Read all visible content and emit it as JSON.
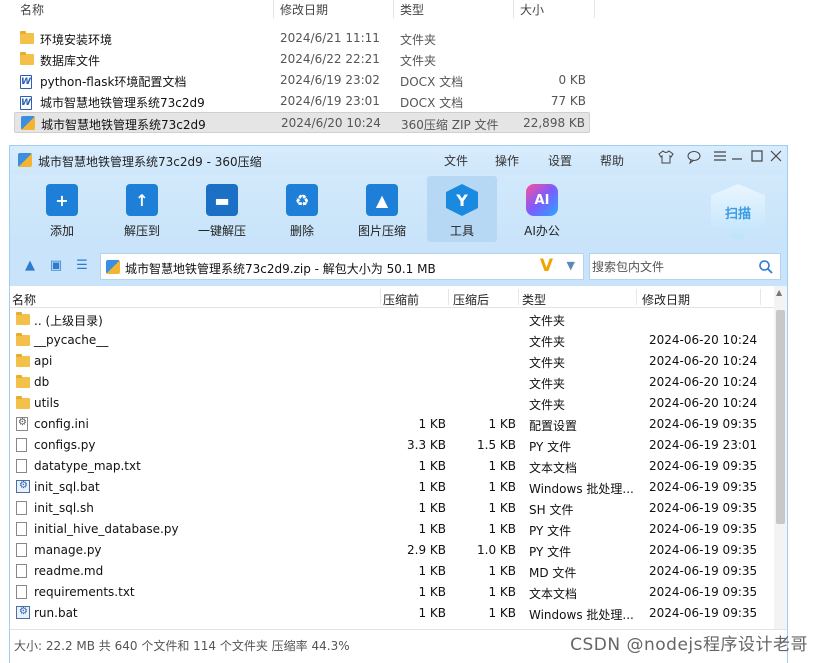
{
  "explorer": {
    "headers": {
      "name": "名称",
      "date": "修改日期",
      "type": "类型",
      "size": "大小"
    },
    "rows": [
      {
        "name": "环境安装环境",
        "date": "2024/6/21 11:11",
        "type": "文件夹",
        "size": "",
        "icon": "folder-icon"
      },
      {
        "name": "数据库文件",
        "date": "2024/6/22 22:21",
        "type": "文件夹",
        "size": "",
        "icon": "folder-icon"
      },
      {
        "name": "python-flask环境配置文档",
        "date": "2024/6/19 23:02",
        "type": "DOCX 文档",
        "size": "0 KB",
        "icon": "word-doc-icon"
      },
      {
        "name": "城市智慧地铁管理系统73c2d9",
        "date": "2024/6/19 23:01",
        "type": "DOCX 文档",
        "size": "77 KB",
        "icon": "word-doc-icon"
      },
      {
        "name": "城市智慧地铁管理系统73c2d9",
        "date": "2024/6/20 10:24",
        "type": "360压缩 ZIP 文件",
        "size": "22,898 KB",
        "icon": "zip-archive-icon",
        "selected": true
      }
    ]
  },
  "window": {
    "title": "城市智慧地铁管理系统73c2d9 - 360压缩",
    "menu": [
      "文件",
      "操作",
      "设置",
      "帮助"
    ]
  },
  "toolbar": {
    "tools": [
      {
        "label": "添加",
        "icon": "add-icon"
      },
      {
        "label": "解压到",
        "icon": "extract-to-icon"
      },
      {
        "label": "一键解压",
        "icon": "one-click-extract-icon"
      },
      {
        "label": "删除",
        "icon": "delete-icon"
      },
      {
        "label": "图片压缩",
        "icon": "image-compress-icon"
      },
      {
        "label": "工具",
        "icon": "tools-icon",
        "active": true
      },
      {
        "label": "AI办公",
        "icon": "ai-office-icon"
      }
    ],
    "scan_label": "扫描"
  },
  "pathbar": {
    "path": "城市智慧地铁管理系统73c2d9.zip - 解包大小为 50.1 MB",
    "search_placeholder": "搜索包内文件"
  },
  "list": {
    "headers": {
      "name": "名称",
      "csize": "压缩前",
      "psize": "压缩后",
      "type": "类型",
      "date": "修改日期"
    },
    "rows": [
      {
        "name": ".. (上级目录)",
        "csize": "",
        "psize": "",
        "type": "文件夹",
        "date": "",
        "icon": "folder-icon"
      },
      {
        "name": "__pycache__",
        "csize": "",
        "psize": "",
        "type": "文件夹",
        "date": "2024-06-20 10:24",
        "icon": "folder-icon"
      },
      {
        "name": "api",
        "csize": "",
        "psize": "",
        "type": "文件夹",
        "date": "2024-06-20 10:24",
        "icon": "folder-icon"
      },
      {
        "name": "db",
        "csize": "",
        "psize": "",
        "type": "文件夹",
        "date": "2024-06-20 10:24",
        "icon": "folder-icon"
      },
      {
        "name": "utils",
        "csize": "",
        "psize": "",
        "type": "文件夹",
        "date": "2024-06-20 10:24",
        "icon": "folder-icon"
      },
      {
        "name": "config.ini",
        "csize": "1 KB",
        "psize": "1 KB",
        "type": "配置设置",
        "date": "2024-06-19 09:35",
        "icon": "config-file-icon"
      },
      {
        "name": "configs.py",
        "csize": "3.3 KB",
        "psize": "1.5 KB",
        "type": "PY 文件",
        "date": "2024-06-19 23:01",
        "icon": "file-icon"
      },
      {
        "name": "datatype_map.txt",
        "csize": "1 KB",
        "psize": "1 KB",
        "type": "文本文档",
        "date": "2024-06-19 09:35",
        "icon": "file-icon"
      },
      {
        "name": "init_sql.bat",
        "csize": "1 KB",
        "psize": "1 KB",
        "type": "Windows 批处理...",
        "date": "2024-06-19 09:35",
        "icon": "batch-file-icon"
      },
      {
        "name": "init_sql.sh",
        "csize": "1 KB",
        "psize": "1 KB",
        "type": "SH 文件",
        "date": "2024-06-19 09:35",
        "icon": "file-icon"
      },
      {
        "name": "initial_hive_database.py",
        "csize": "1 KB",
        "psize": "1 KB",
        "type": "PY 文件",
        "date": "2024-06-19 09:35",
        "icon": "file-icon"
      },
      {
        "name": "manage.py",
        "csize": "2.9 KB",
        "psize": "1.0 KB",
        "type": "PY 文件",
        "date": "2024-06-19 09:35",
        "icon": "file-icon"
      },
      {
        "name": "readme.md",
        "csize": "1 KB",
        "psize": "1 KB",
        "type": "MD 文件",
        "date": "2024-06-19 09:35",
        "icon": "file-icon"
      },
      {
        "name": "requirements.txt",
        "csize": "1 KB",
        "psize": "1 KB",
        "type": "文本文档",
        "date": "2024-06-19 09:35",
        "icon": "file-icon"
      },
      {
        "name": "run.bat",
        "csize": "1 KB",
        "psize": "1 KB",
        "type": "Windows 批处理...",
        "date": "2024-06-19 09:35",
        "icon": "batch-file-icon"
      }
    ]
  },
  "status": "大小: 22.2 MB 共 640 个文件和 114 个文件夹 压缩率 44.3%",
  "watermark": "CSDN @nodejs程序设计老哥",
  "colors": {
    "accent": "#1e7fd8",
    "toolbar_bg": "#c8e3fa",
    "titlebar_bg": "#d8ecfc",
    "folder": "#f3c14a"
  }
}
